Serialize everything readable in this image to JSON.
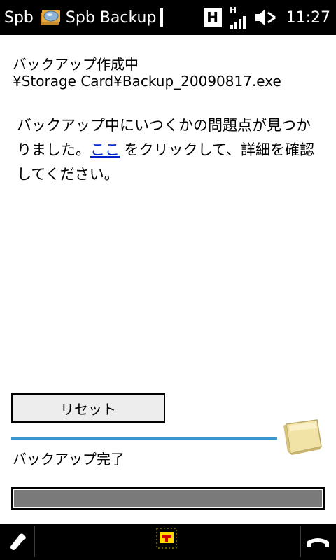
{
  "status_bar": {
    "start_label": "Spb",
    "app_title": "Spb Backup",
    "network_label": "H",
    "time": "11:27"
  },
  "content": {
    "title_line1": "バックアップ作成中",
    "title_line2": "¥Storage Card¥Backup_20090817.exe",
    "message_part1": "バックアップ中にいつくかの問題点が見つかりました。",
    "message_link": "ここ",
    "message_part2": " をクリックして、詳細を確認してください。",
    "reset_button": "リセット",
    "status_label": "バックアップ完了",
    "progress": 1.0
  },
  "colors": {
    "link": "#0022cc",
    "accent_line": "#3b95cf",
    "progress_fill": "#7a7a7a"
  },
  "icons": {
    "status_app": "spb-backup-app-icon",
    "signal": "signal-strength-icon",
    "volume": "speaker-muted-icon",
    "cube": "backup-cube-icon",
    "left_softkey": "call-icon",
    "center_softkey": "start-menu-icon",
    "right_softkey": "end-call-icon"
  }
}
